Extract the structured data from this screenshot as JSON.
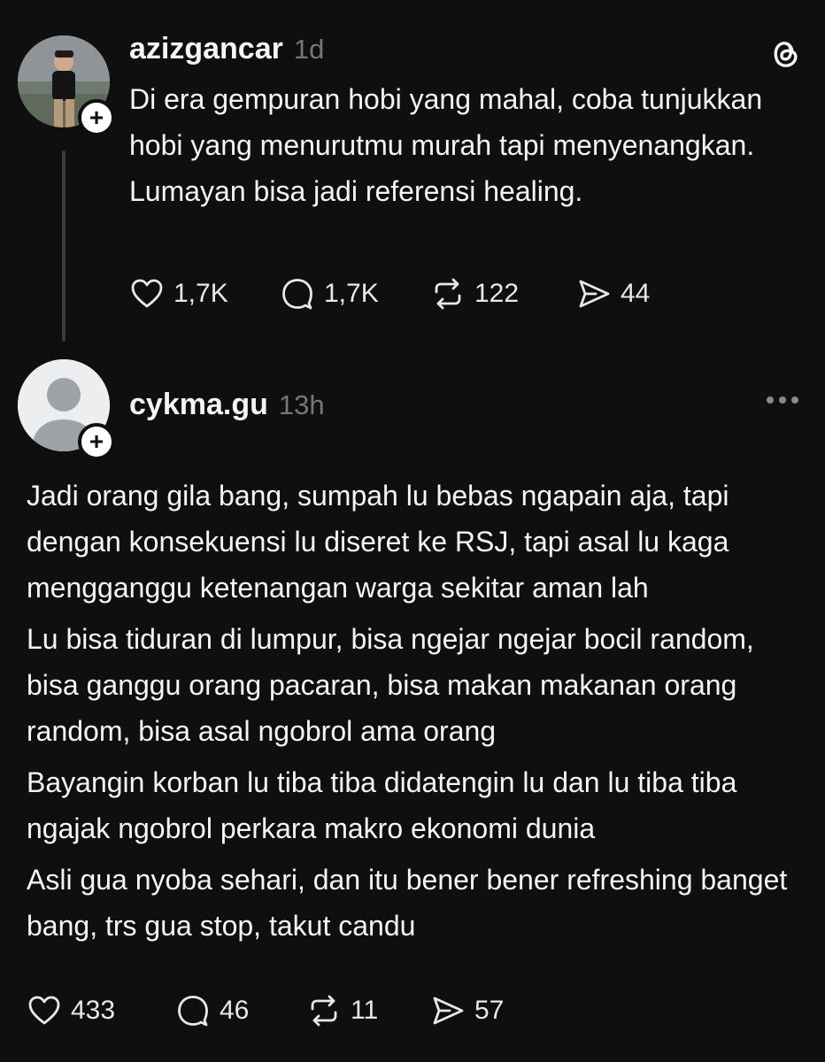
{
  "original_post": {
    "username": "azizgancar",
    "time": "1d",
    "text": "Di era gempuran hobi yang mahal, coba tunjukkan hobi yang menurutmu murah tapi menyenangkan. Lumayan bisa jadi referensi healing.",
    "likes": "1,7K",
    "comments": "1,7K",
    "reposts": "122",
    "shares": "44",
    "follow_label": "+"
  },
  "reply_post": {
    "username": "cykma.gu",
    "time": "13h",
    "paragraphs": [
      "Jadi orang gila bang, sumpah lu bebas ngapain aja, tapi dengan konsekuensi lu diseret ke RSJ, tapi asal lu kaga mengganggu ketenangan warga sekitar aman lah",
      "Lu bisa tiduran di lumpur, bisa ngejar ngejar bocil random, bisa ganggu orang pacaran, bisa makan makanan orang random, bisa asal ngobrol ama orang",
      "Bayangin korban lu tiba tiba didatengin lu dan lu tiba tiba ngajak ngobrol perkara makro ekonomi dunia",
      "Asli gua nyoba sehari, dan itu bener bener refreshing banget bang, trs gua stop, takut candu"
    ],
    "likes": "433",
    "comments": "46",
    "reposts": "11",
    "shares": "57",
    "follow_label": "+"
  },
  "icons": {
    "brand": "threads-logo-icon",
    "like": "heart-icon",
    "comment": "comment-bubble-icon",
    "repost": "repost-icon",
    "share": "send-icon",
    "more": "more-dots-icon"
  },
  "colors": {
    "background": "#0f0f0f",
    "text": "#f3f5f7",
    "muted": "#777777"
  }
}
